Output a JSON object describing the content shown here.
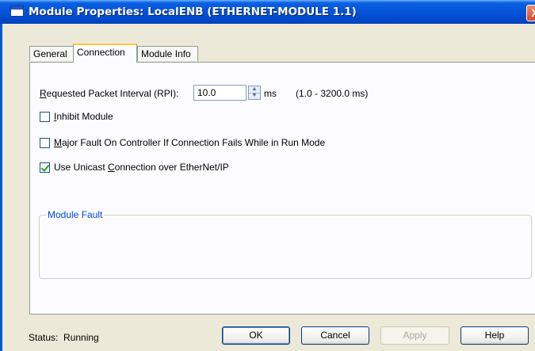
{
  "window": {
    "title": "Module Properties: LocalENB (ETHERNET-MODULE 1.1)",
    "close_glyph": "X"
  },
  "tabs": [
    {
      "label": "General",
      "active": false
    },
    {
      "label": "Connection",
      "active": true
    },
    {
      "label": "Module Info",
      "active": false
    }
  ],
  "connection": {
    "rpi_label_accel": "R",
    "rpi_label_rest": "equested Packet Interval (RPI):",
    "rpi_value": "10.0",
    "rpi_unit": "ms",
    "rpi_range": "(1.0 - 3200.0 ms)",
    "inhibit": {
      "accel": "I",
      "rest": "nhibit Module",
      "checked": false
    },
    "major_fault": {
      "accel": "M",
      "rest": "ajor Fault On Controller If Connection Fails While in Run Mode",
      "checked": false
    },
    "unicast": {
      "pre": "Use Unicast ",
      "accel": "C",
      "rest": "onnection over EtherNet/IP",
      "checked": true
    },
    "module_fault_label": "Module Fault"
  },
  "footer": {
    "status_label": "Status:",
    "status_value": "Running",
    "ok": "OK",
    "cancel": "Cancel",
    "apply": "Apply",
    "help": "Help"
  },
  "icons": {
    "title_icon": "window-icon",
    "spin_up": "▲",
    "spin_down": "▼"
  },
  "colors": {
    "titlebar": "#0553d8",
    "tab_highlight": "#ffc83c",
    "groupbox_legend": "#0046d5",
    "checkmark": "#21a121"
  }
}
